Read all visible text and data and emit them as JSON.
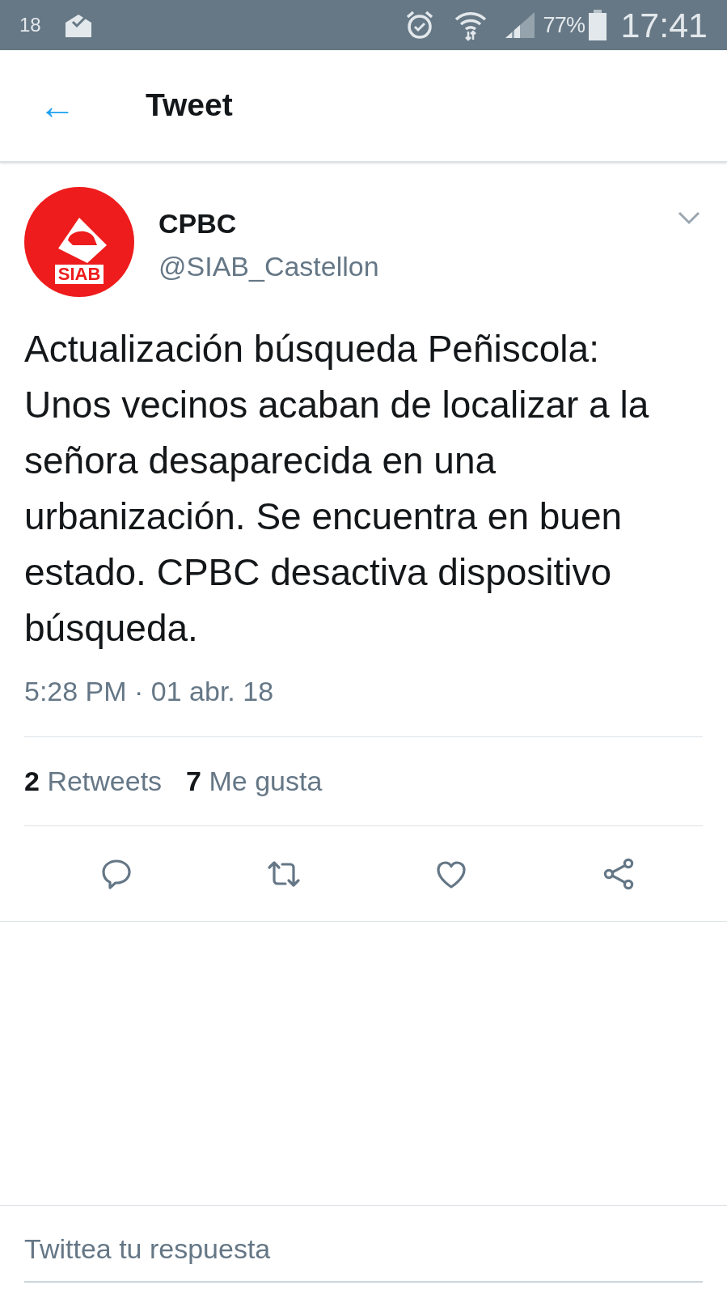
{
  "status_bar": {
    "temperature": "18",
    "battery": "77%",
    "time": "17:41"
  },
  "header": {
    "back": "←",
    "title": "Tweet"
  },
  "tweet": {
    "avatar_text": "SIAB",
    "name": "CPBC",
    "handle": "@SIAB_Castellon",
    "text": "Actualización búsqueda Peñiscola: Unos vecinos acaban de localizar a la señora desaparecida en una urbanización. Se encuentra en buen estado. CPBC desactiva dispositivo búsqueda.",
    "timestamp": "5:28 PM · 01 abr. 18",
    "stats": [
      {
        "count": "2",
        "label": "Retweets"
      },
      {
        "count": "7",
        "label": "Me gusta"
      }
    ],
    "actions": [
      {
        "kind": "reply"
      },
      {
        "kind": "retweet"
      },
      {
        "kind": "like"
      },
      {
        "kind": "share"
      }
    ]
  },
  "reply": {
    "placeholder": "Twittea tu respuesta"
  }
}
